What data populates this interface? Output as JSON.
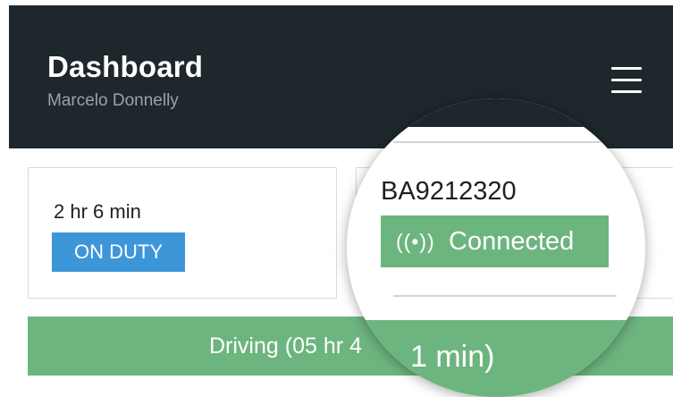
{
  "header": {
    "title": "Dashboard",
    "subtitle": "Marcelo Donnelly",
    "menu_icon": "hamburger-menu-icon"
  },
  "status_card": {
    "duty_time": "2 hr 6 min",
    "duty_status": "ON DUTY"
  },
  "device_card": {
    "device_id": "BA9212320",
    "connection_icon": "signal-broadcast-icon",
    "connection_glyph": "((•))",
    "connection_status": "Connected"
  },
  "driving_bar": {
    "label": "Driving (05 hr 4",
    "magnified_fragment": "1 min)"
  },
  "colors": {
    "header_bg": "#1e272b",
    "duty_badge": "#3d96d8",
    "green": "#6db57f"
  }
}
